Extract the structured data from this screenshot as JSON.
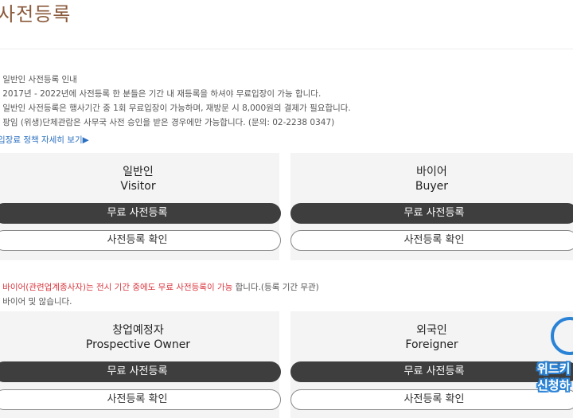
{
  "page": {
    "title": "사전등록"
  },
  "notice": {
    "lines": [
      "' 일반인 사전등록 인내",
      "' 2017년 - 2022년에 사전등록 한 분들은 기간 내 재등록을 하셔야 무료입장이 가능 합니다.",
      "' 일반인 사전등록은 행사기간 중 1회 무료입장이 가능하며, 재방문 시 8,000원의 결제가 필요합니다.",
      "' 팡임 (위생)단체관람은 사무국 사전 승인을 받은 경우에만 가능합니다. (문의: 02-2238 0347)"
    ],
    "policy_link": "입장료 정책 자세히 보기▶"
  },
  "cards": [
    {
      "kr": "일반인",
      "en": "Visitor",
      "register": "무료 사전등록",
      "check": "사전등록 확인"
    },
    {
      "kr": "바이어",
      "en": "Buyer",
      "register": "무료 사전등록",
      "check": "사전등록 확인"
    },
    {
      "kr": "창업예정자",
      "en": "Prospective Owner",
      "register": "무료 사전등록",
      "check": "사전등록 확인"
    },
    {
      "kr": "외국인",
      "en": "Foreigner",
      "register": "무료 사전등록",
      "check": "사전등록 확인"
    }
  ],
  "buyer_note": {
    "prefix": "' ",
    "highlight": "바이어(관련업계종사자)는 전시 기간 중에도 무료 사전등록이 가능",
    "suffix": " 합니다.(등록 기간 무관)",
    "line2": "' 바이어 및 않습니다."
  },
  "promo": {
    "line1": "위드키",
    "line2": "신청하"
  },
  "colors": {
    "title": "#8a5a3c",
    "link": "#2a6fc0",
    "highlight": "#d9363e",
    "dark_button": "#3e3e3e",
    "promo": "#2a83d6"
  }
}
